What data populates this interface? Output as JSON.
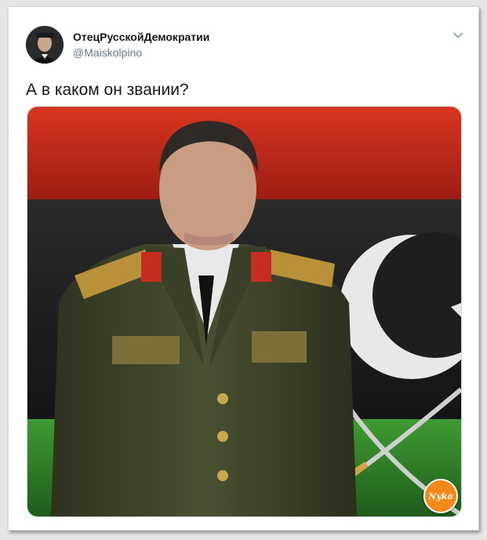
{
  "tweet": {
    "author_name": "ОтецРусскойДемократии",
    "author_handle": "@Maiskolpino",
    "text": "А в каком он звании?",
    "menu_icon": "chevron-down-icon",
    "avatar_icon": "avatar"
  },
  "watermark": {
    "text": "Nyka"
  },
  "colors": {
    "flag_red": "#c42b1f",
    "flag_black": "#1c1c1c",
    "flag_green": "#2f8a2a",
    "uniform_green": "#3a3f27",
    "handle_gray": "#657786",
    "watermark_orange": "#f28a1a"
  }
}
